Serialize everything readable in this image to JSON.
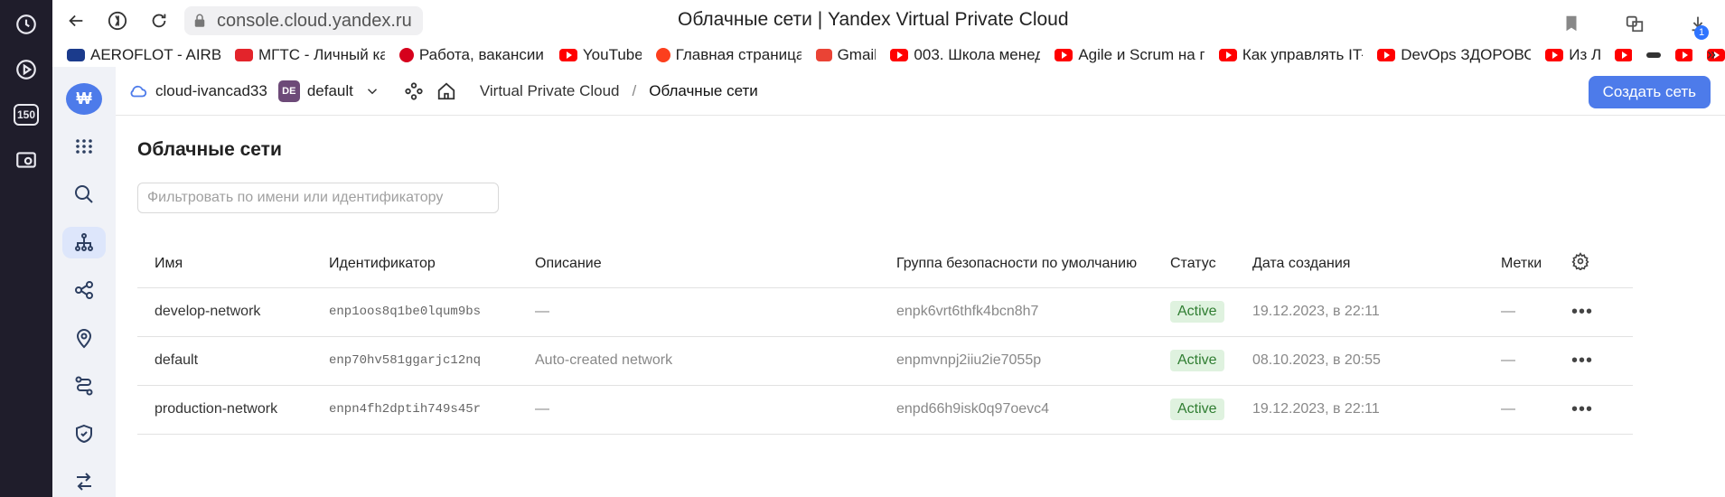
{
  "browser": {
    "address": "console.cloud.yandex.ru",
    "window_title": "Облачные сети | Yandex Virtual Private Cloud",
    "rail_badge": "150",
    "download_count": "1",
    "bookmarks": [
      {
        "label": "AEROFLOT - AIRBUS",
        "icon_color": "#1b3b8c"
      },
      {
        "label": "МГТС - Личный ка",
        "icon_color": "#e3242b"
      },
      {
        "label": "Работа, вакансии,",
        "icon_color": "#d6001c"
      },
      {
        "label": "YouTube",
        "icon_color": "#ff0000"
      },
      {
        "label": "Главная страница",
        "icon_color": "#fc3f1d"
      },
      {
        "label": "Gmail",
        "icon_color": "#ea4335"
      },
      {
        "label": "003. Школа менед",
        "icon_color": "#ff0000"
      },
      {
        "label": "Agile и Scrum на п",
        "icon_color": "#ff0000"
      },
      {
        "label": "Как управлять IT-",
        "icon_color": "#ff0000"
      },
      {
        "label": "DevOps ЗДОРОВО",
        "icon_color": "#ff0000"
      },
      {
        "label": "Из Л",
        "icon_color": "#ff0000"
      }
    ]
  },
  "console": {
    "logo": "₩",
    "cloud_name": "cloud-ivancad33",
    "folder_badge": "DE",
    "folder_name": "default",
    "breadcrumb_service": "Virtual Private Cloud",
    "breadcrumb_sep": "/",
    "breadcrumb_current": "Облачные сети",
    "create_button": "Создать сеть",
    "accent": "#4d7bea"
  },
  "main": {
    "title": "Облачные сети",
    "filter_placeholder": "Фильтровать по имени или идентификатору",
    "columns": {
      "name": "Имя",
      "id": "Идентификатор",
      "description": "Описание",
      "security_group": "Группа безопасности по умолчанию",
      "status": "Статус",
      "created": "Дата создания",
      "labels": "Метки"
    },
    "rows": [
      {
        "name": "develop-network",
        "id": "enp1oos8q1be0lqum9bs",
        "description": "—",
        "security_group": "enpk6vrt6thfk4bcn8h7",
        "status": "Active",
        "created": "19.12.2023, в 22:11",
        "labels": "—"
      },
      {
        "name": "default",
        "id": "enp70hv581ggarjc12nq",
        "description": "Auto-created network",
        "security_group": "enpmvnpj2iiu2ie7055p",
        "status": "Active",
        "created": "08.10.2023, в 20:55",
        "labels": "—"
      },
      {
        "name": "production-network",
        "id": "enpn4fh2dptih749s45r",
        "description": "—",
        "security_group": "enpd66h9isk0q97oevc4",
        "status": "Active",
        "created": "19.12.2023, в 22:11",
        "labels": "—"
      }
    ],
    "row_menu": "•••",
    "status_color": "#2f7d31"
  }
}
